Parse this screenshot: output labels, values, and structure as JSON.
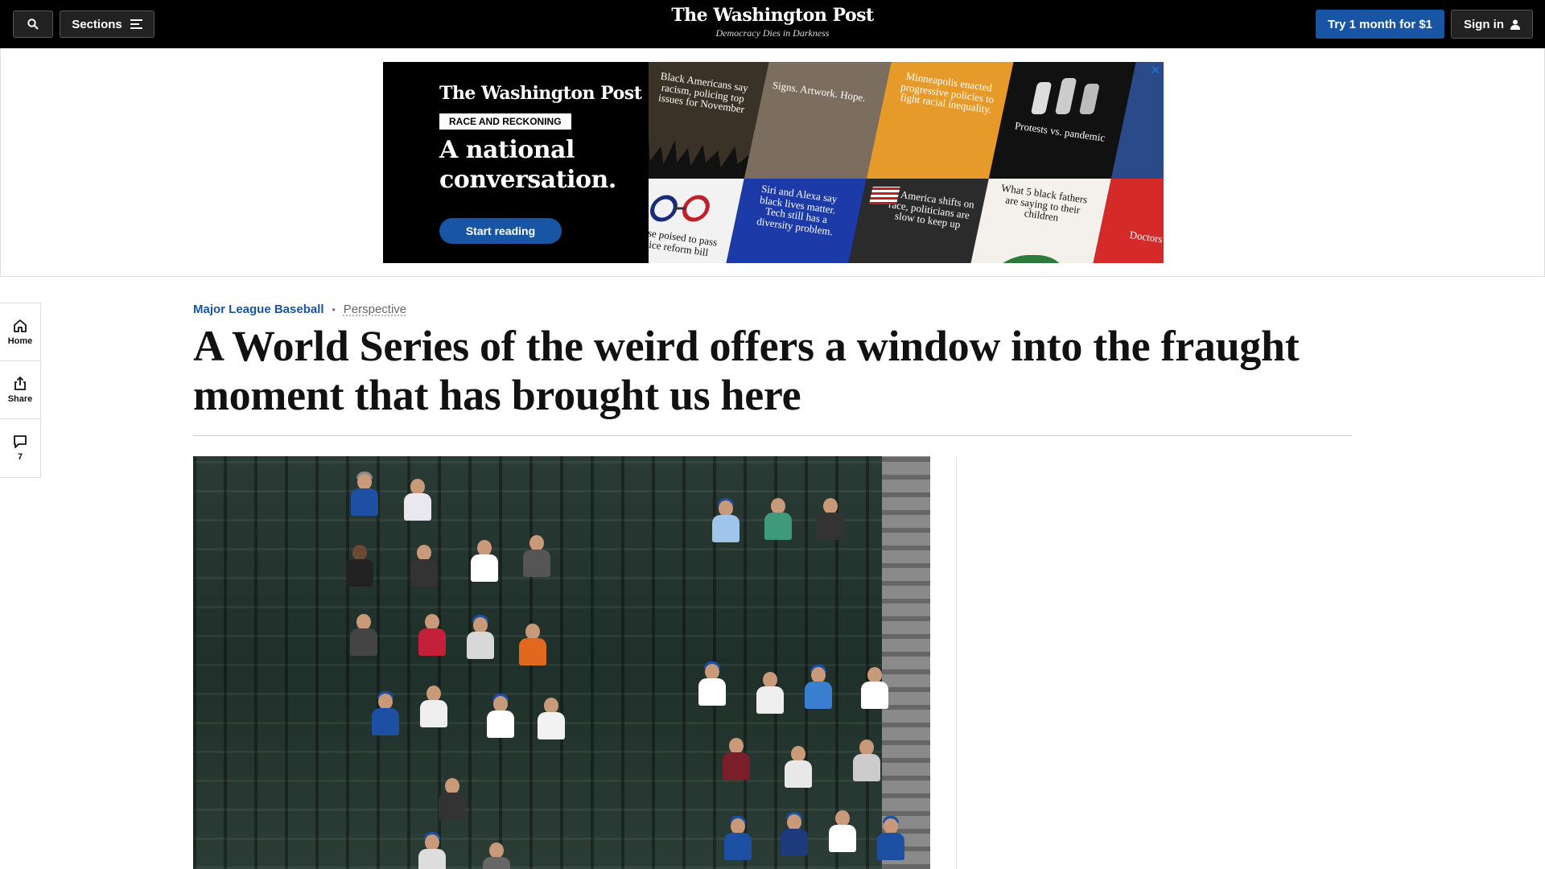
{
  "nav": {
    "sections_label": "Sections",
    "logo": "The Washington Post",
    "tagline": "Democracy Dies in Darkness",
    "try_label": "Try 1 month for $1",
    "signin_label": "Sign in"
  },
  "ad": {
    "logo": "The Washington Post",
    "kicker": "RACE AND RECKONING",
    "headline_line1": "A national",
    "headline_line2": "conversation.",
    "cta": "Start reading",
    "close": "✕",
    "tiles": [
      "Black Americans say racism, policing top issues for November",
      "Signs. Artwork. Hope.",
      "Minneapolis enacted progressive policies to fight racial inequality.",
      "Protests vs. pandemic",
      "House poised to pass police reform bill",
      "Siri and Alexa say black lives matter. Tech still has a diversity problem.",
      "As America shifts on race, politicians are slow to keep up",
      "What 5 black fathers are saying to their children",
      "Doctors racism in h"
    ]
  },
  "rail": {
    "home_label": "Home",
    "share_label": "Share",
    "comments_count": "7"
  },
  "article": {
    "section": "Major League Baseball",
    "label": "Perspective",
    "headline": "A World Series of the weird offers a window into the fraught moment that has brought us here"
  },
  "colors": {
    "nav_bg": "#000000",
    "accent_blue": "#1955a5",
    "headline_text": "#111111"
  }
}
